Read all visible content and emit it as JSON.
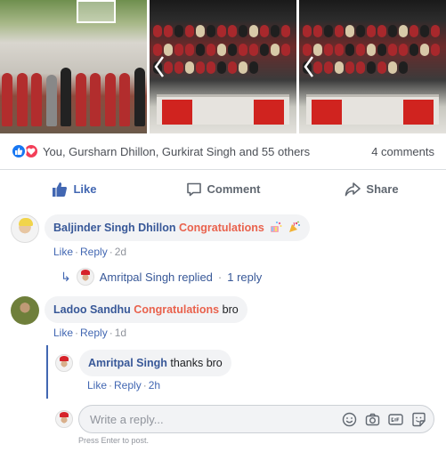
{
  "reactions": {
    "summary": "You, Gursharn Dhillon, Gurkirat Singh and 55 others",
    "comments_count": "4 comments",
    "icons": [
      "like-icon",
      "love-icon"
    ]
  },
  "actions": {
    "like": "Like",
    "comment": "Comment",
    "share": "Share"
  },
  "comments": [
    {
      "author": "Baljinder Singh Dhillon",
      "highlight": "Congratulations",
      "text": "",
      "emojis": [
        "confetti-icon",
        "party-popper-icon"
      ],
      "like": "Like",
      "reply": "Reply",
      "time": "2d",
      "replies_link": {
        "author_action": "Amritpal Singh replied",
        "count": "1 reply"
      }
    },
    {
      "author": "Ladoo Sandhu",
      "highlight": "Congratulations",
      "text": "bro",
      "like": "Like",
      "reply": "Reply",
      "time": "1d",
      "replies": [
        {
          "author": "Amritpal Singh",
          "text": "thanks bro",
          "like": "Like",
          "reply": "Reply",
          "time": "2h"
        }
      ]
    }
  ],
  "composer": {
    "placeholder": "Write a reply...",
    "hint": "Press Enter to post.",
    "tools": [
      "emoji-icon",
      "camera-icon",
      "gif-icon",
      "sticker-icon"
    ]
  },
  "separator": "·",
  "colors": {
    "link_blue": "#385898",
    "like_blue": "#4267b2",
    "highlight": "#e9624d",
    "muted": "#90949c",
    "bubble_bg": "#f2f3f5"
  }
}
